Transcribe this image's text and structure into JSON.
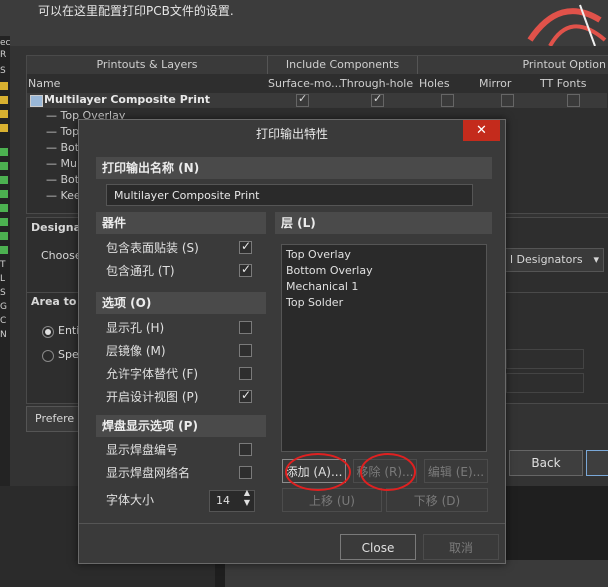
{
  "background": {
    "header_text": "可以在这里配置打印PCB文件的设置.",
    "columns": {
      "group1": "Printouts & Layers",
      "group2": "Include Components",
      "group3": "Printout Option",
      "name": "Name",
      "surface": "Surface-mo...",
      "through": "Through-hole",
      "holes": "Holes",
      "mirror": "Mirror",
      "ttfonts": "TT Fonts"
    },
    "tree_root": "Multilayer Composite Print",
    "tree_items": [
      "Top Overlay",
      "Top",
      "Bot",
      "Mu",
      "Bot",
      "Kee"
    ],
    "designators_label": "Designat",
    "choose_label": "Choose",
    "designators_dropdown": "l Designators",
    "area_label": "Area to P",
    "radio1": "Enti",
    "radio2": "Spe",
    "pref_btn": "Prefere",
    "back_btn": "Back",
    "left_strip_labels": [
      "ec",
      "R",
      "S",
      "",
      "",
      "D",
      "T",
      "L",
      "S",
      "G",
      "C",
      "N"
    ]
  },
  "dialog": {
    "title": "打印输出特性",
    "close": "✕",
    "print_name_section": "打印输出名称 (N)",
    "print_name_value": "Multilayer Composite Print",
    "components_section": "器件",
    "include_smd": "包含表面贴装 (S)",
    "include_th": "包含通孔 (T)",
    "options_section": "选项 (O)",
    "show_holes": "显示孔 (H)",
    "mirror_layers": "层镜像 (M)",
    "allow_font_sub": "允许字体替代 (F)",
    "open_design_view": "开启设计视图 (P)",
    "pad_section": "焊盘显示选项 (P)",
    "show_pad_numbers": "显示焊盘编号",
    "show_pad_nets": "显示焊盘网络名",
    "font_size_label": "字体大小",
    "font_size_value": "14",
    "layers_section": "层 (L)",
    "layers": [
      "Top Overlay",
      "Bottom Overlay",
      "Mechanical 1",
      "Top Solder"
    ],
    "add_btn": "添加 (A)...",
    "remove_btn": "移除 (R)...",
    "edit_btn": "编辑 (E)...",
    "up_btn": "上移 (U)",
    "down_btn": "下移 (D)",
    "close_btn": "Close",
    "cancel_btn": "取消"
  }
}
